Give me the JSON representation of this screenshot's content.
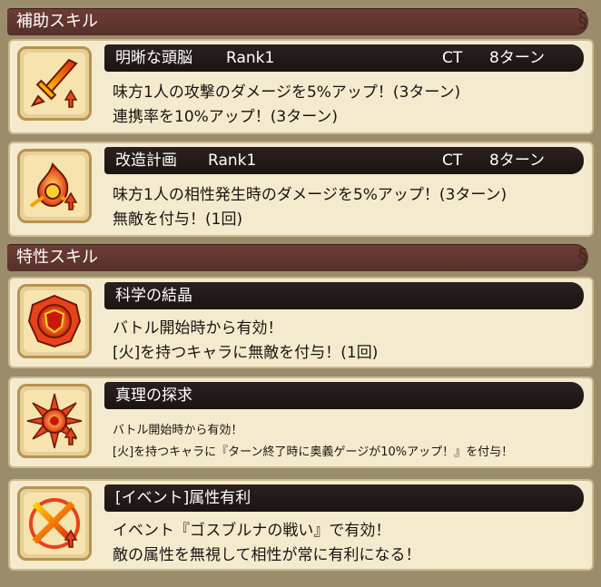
{
  "sections": {
    "support_title": "補助スキル",
    "trait_title": "特性スキル"
  },
  "support_skills": [
    {
      "name": "明晰な頭脳",
      "rank": "Rank1",
      "ct_label": "CT",
      "ct_value": "8ターン",
      "line1": "味方1人の攻撃のダメージを5%アップ！(3ターン)",
      "line2": "連携率を10%アップ！(3ターン)",
      "icon": "sword-up-icon"
    },
    {
      "name": "改造計画",
      "rank": "Rank1",
      "ct_label": "CT",
      "ct_value": "8ターン",
      "line1": "味方1人の相性発生時のダメージを5%アップ！(3ターン)",
      "line2": "無敵を付与！(1回)",
      "icon": "flame-shield-icon"
    }
  ],
  "trait_skills": [
    {
      "name": "科学の結晶",
      "line1": "バトル開始時から有効！",
      "line2": "[火]を持つキャラに無敵を付与！(1回)",
      "icon": "fire-shield-icon"
    },
    {
      "name": "真理の探求",
      "line1": "バトル開始時から有効！",
      "line2": "[火]を持つキャラに『ターン終了時に奥義ゲージが10%アップ！』を付与！",
      "icon": "fire-star-icon"
    },
    {
      "name": "[イベント]属性有利",
      "line1": "イベント『ゴスブルナの戦い』で有効！",
      "line2": "敵の属性を無視して相性が常に有利になる！",
      "icon": "fire-cross-icon"
    }
  ],
  "colors": {
    "accent_fire": "#e8421a",
    "header_bg": "#5e332d",
    "card_bg": "#f4ebcf"
  }
}
